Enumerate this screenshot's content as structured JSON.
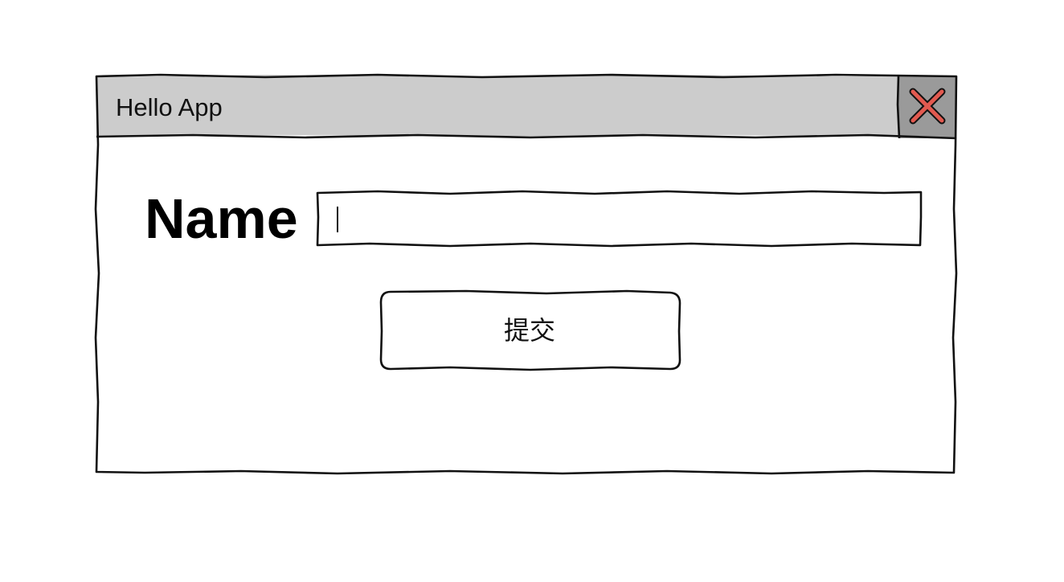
{
  "window": {
    "title": "Hello App",
    "close_button": {
      "icon": "close-icon",
      "icon_color": "#e25a50",
      "background": "#9a9a9a"
    },
    "titlebar_color": "#cccccc"
  },
  "form": {
    "name_label": "Name",
    "name_input": {
      "value": "",
      "placeholder": ""
    },
    "submit_label": "提交"
  }
}
